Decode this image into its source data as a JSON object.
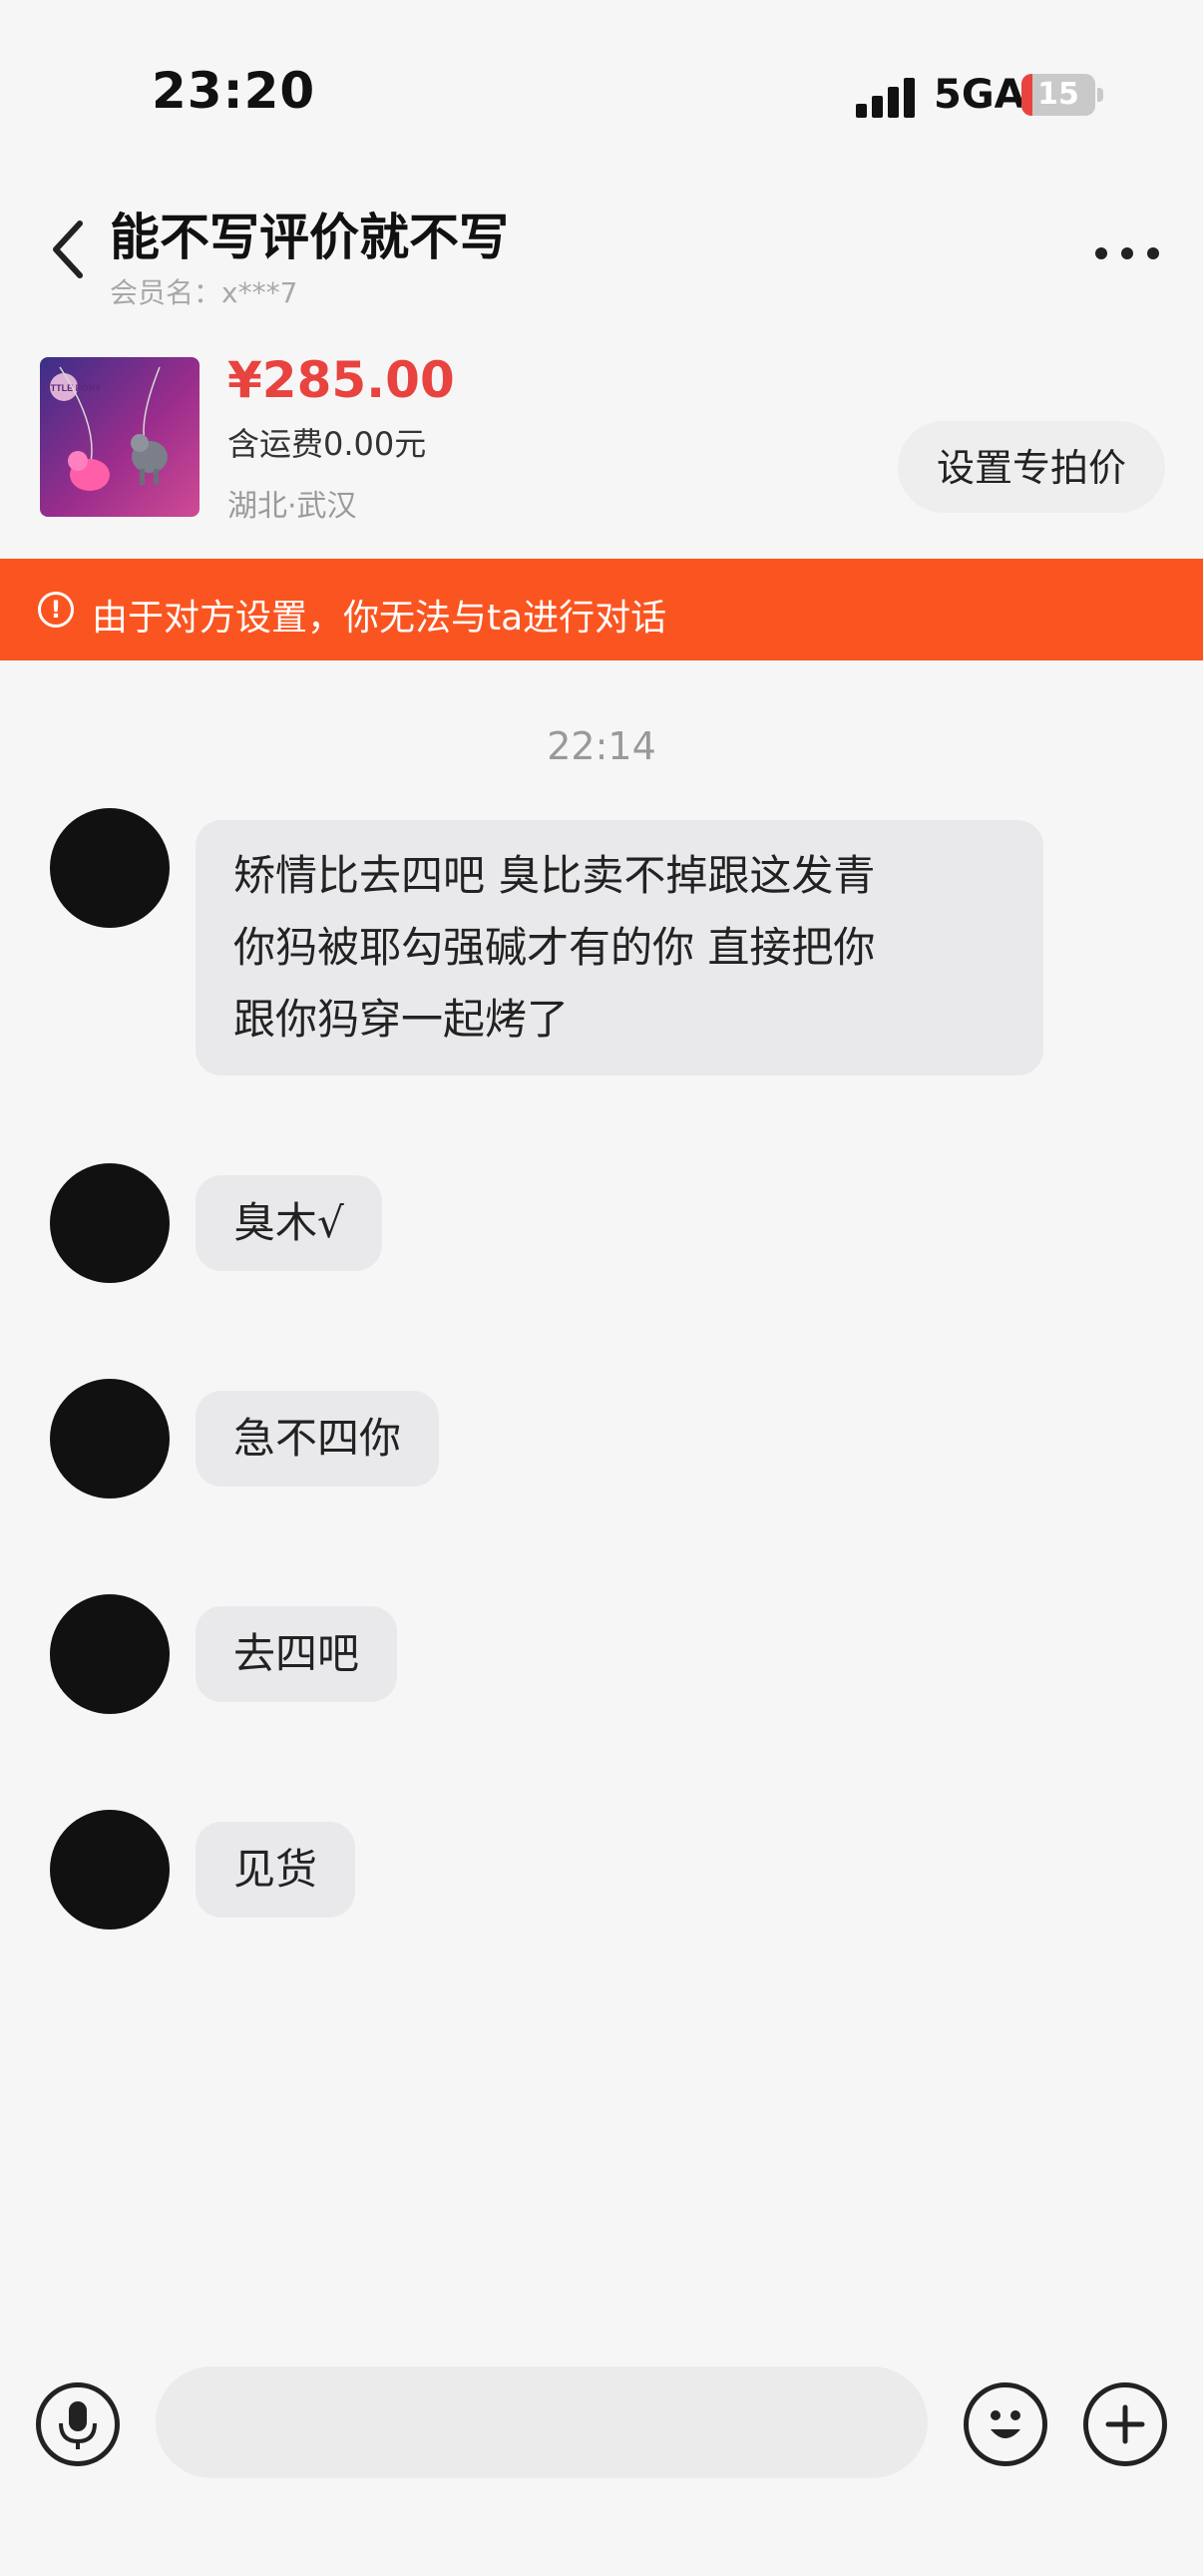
{
  "status_bar": {
    "time": "23:20",
    "network": "5GA",
    "battery": "15",
    "battery_level_pct": 15
  },
  "header": {
    "title": "能不写评价就不写",
    "member_label": "会员名：x***7",
    "icons": [
      "back-chevron-icon",
      "more-dots-icon"
    ]
  },
  "product": {
    "price": "¥285.00",
    "shipping": "含运费0.00元",
    "location": "湖北·武汉",
    "action_label": "设置专拍价",
    "image": "product-necklace-image",
    "image_text": "MY LITTLE PONY"
  },
  "banner": {
    "icon": "warning-circle-icon",
    "text": "由于对方设置，你无法与ta进行对话",
    "color": "#fa5520"
  },
  "chat": {
    "timestamp": "22:14",
    "messages": [
      {
        "lines": [
          "矫情比去四吧 臭比卖不掉跟这发青",
          "你犸被耶勾强碱才有的你 直接把你",
          "跟你犸穿一起烤了"
        ]
      },
      {
        "lines": [
          "臭木√"
        ]
      },
      {
        "lines": [
          "急不四你"
        ]
      },
      {
        "lines": [
          "去四吧"
        ]
      },
      {
        "lines": [
          "见货"
        ]
      }
    ]
  },
  "input_bar": {
    "icons": [
      "microphone-icon",
      "emoji-icon",
      "plus-icon"
    ]
  },
  "colors": {
    "accent": "#e8433e",
    "banner": "#fa5520",
    "bubble": "#e9e9ec",
    "background": "#f6f6f6"
  }
}
